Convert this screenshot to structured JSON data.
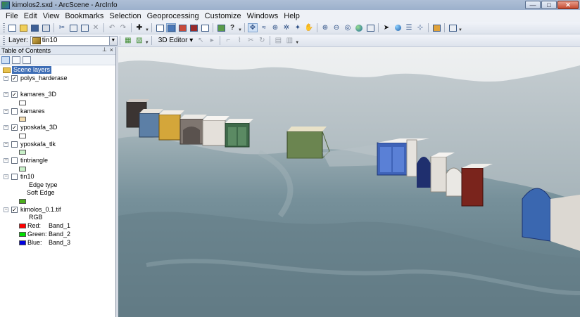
{
  "window": {
    "title": "kimolos2.sxd - ArcScene - ArcInfo",
    "minimize_glyph": "—",
    "maximize_glyph": "□",
    "close_glyph": "✕"
  },
  "menu": {
    "items": [
      "File",
      "Edit",
      "View",
      "Bookmarks",
      "Selection",
      "Geoprocessing",
      "Customize",
      "Windows",
      "Help"
    ]
  },
  "toolbar2": {
    "layer_label": "Layer:",
    "layer_value": "tin10",
    "editor_label": "3D Editor"
  },
  "toc": {
    "title": "Table of Contents",
    "pin_glyph": "⊥",
    "close_glyph": "×",
    "scene_layers_label": "Scene layers",
    "layers": {
      "polys_harderase": {
        "name": "polys_harderase",
        "checked": true
      },
      "kamares_3D": {
        "name": "kamares_3D",
        "checked": true,
        "swatch_color": "#ffffff"
      },
      "kamares": {
        "name": "kamares",
        "checked": false,
        "swatch_color": "#f3dcb0"
      },
      "yposkafa_3D": {
        "name": "yposkafa_3D",
        "checked": true,
        "swatch_color": "#ffffff"
      },
      "yposkafa_tlk": {
        "name": "yposkafa_tlk",
        "checked": false,
        "swatch_color": "#c8f0c8"
      },
      "tintriangle": {
        "name": "tintriangle",
        "checked": false,
        "swatch_color": "#c8f0c8"
      },
      "tin10": {
        "name": "tin10",
        "checked": false,
        "edge_type_label": "Edge type",
        "soft_edge_label": "Soft Edge",
        "swatch_color": "#4caf1c"
      },
      "kimolos": {
        "name": "kimolos_0.1.tif",
        "checked": true,
        "rgb_label": "RGB",
        "bands": [
          {
            "channel": "Red:",
            "band": "Band_1",
            "color": "#ff0000"
          },
          {
            "channel": "Green:",
            "band": "Band_2",
            "color": "#00e000"
          },
          {
            "channel": "Blue:",
            "band": "Band_3",
            "color": "#0000e0"
          }
        ]
      }
    }
  },
  "colors": {
    "selection_blue": "#3d6db5",
    "sky": "#dfe3e6",
    "terrain": "#6f8791"
  },
  "icons": {
    "checkbox_checked": "✓",
    "expander_minus": "−"
  }
}
